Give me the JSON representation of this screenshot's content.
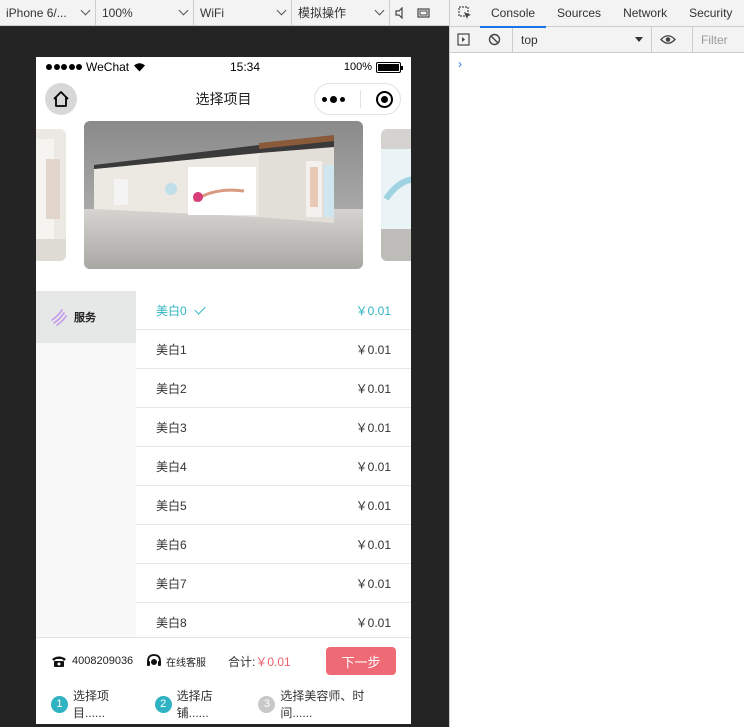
{
  "devtools_device_toolbar": {
    "device": "iPhone 6/...",
    "zoom": "100%",
    "network": "WiFi",
    "mode": "模拟操作"
  },
  "devtools_panel": {
    "tabs": [
      "Console",
      "Sources",
      "Network",
      "Security"
    ],
    "active_tab": "Console",
    "context": "top",
    "filter_placeholder": "Filter",
    "prompt_symbol": "›"
  },
  "status_bar": {
    "carrier": "WeChat",
    "time": "15:34",
    "battery": "100%"
  },
  "nav": {
    "title": "选择项目"
  },
  "category": {
    "label": "服务"
  },
  "items": [
    {
      "name": "美白0",
      "price": "￥0.01",
      "selected": true
    },
    {
      "name": "美白1",
      "price": "￥0.01",
      "selected": false
    },
    {
      "name": "美白2",
      "price": "￥0.01",
      "selected": false
    },
    {
      "name": "美白3",
      "price": "￥0.01",
      "selected": false
    },
    {
      "name": "美白4",
      "price": "￥0.01",
      "selected": false
    },
    {
      "name": "美白5",
      "price": "￥0.01",
      "selected": false
    },
    {
      "name": "美白6",
      "price": "￥0.01",
      "selected": false
    },
    {
      "name": "美白7",
      "price": "￥0.01",
      "selected": false
    },
    {
      "name": "美白8",
      "price": "￥0.01",
      "selected": false
    }
  ],
  "bottom": {
    "phone": "4008209036",
    "service": "在线客服",
    "total_label": "合计:",
    "total_amount": "￥0.01",
    "next": "下一步"
  },
  "steps": [
    {
      "num": "1",
      "label": "选择项目......",
      "active": true
    },
    {
      "num": "2",
      "label": "选择店铺......",
      "active": true
    },
    {
      "num": "3",
      "label": "选择美容师、时间......",
      "active": false
    }
  ],
  "colors": {
    "accent": "#2fb3c2",
    "price_red": "#ee5f6b",
    "button": "#ee6a74"
  }
}
